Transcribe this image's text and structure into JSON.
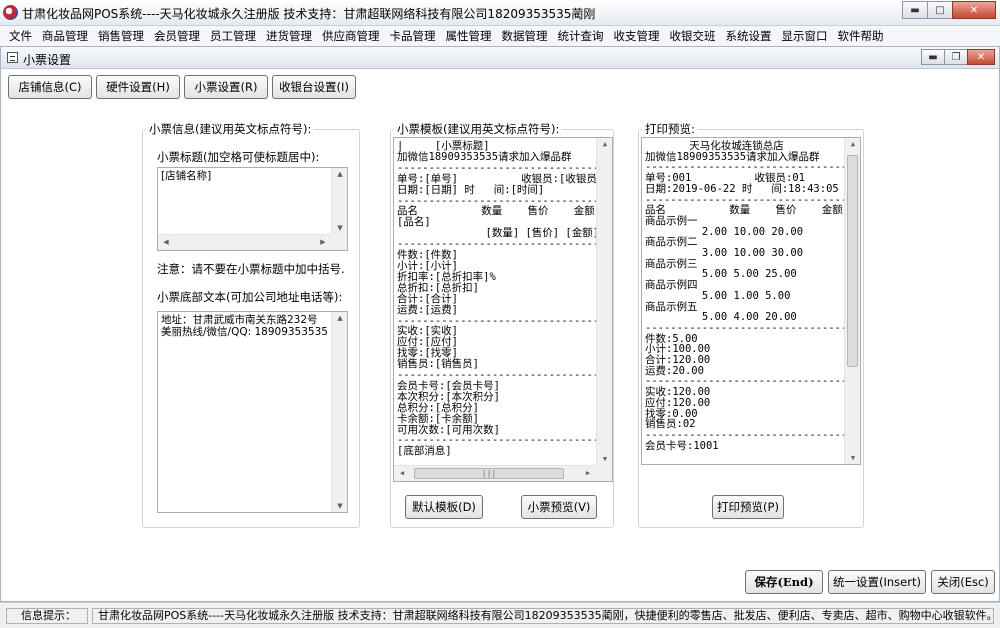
{
  "window": {
    "title": "甘肃化妆品网POS系统----天马化妆城永久注册版  技术支持：甘肃超联网络科技有限公司18209353535蔺刚"
  },
  "menu": [
    "文件",
    "商品管理",
    "销售管理",
    "会员管理",
    "员工管理",
    "进货管理",
    "供应商管理",
    "卡品管理",
    "属性管理",
    "数据管理",
    "统计查询",
    "收支管理",
    "收银交班",
    "系统设置",
    "显示窗口",
    "软件帮助"
  ],
  "dialog": {
    "title": "小票设置"
  },
  "tabs": [
    "店铺信息(C)",
    "硬件设置(H)",
    "小票设置(R)",
    "收银台设置(I)"
  ],
  "info_panel": {
    "caption": "小票信息(建议用英文标点符号):",
    "title_label": "小票标题(加空格可使标题居中):",
    "title_value": "[店铺名称]",
    "note": "注意：请不要在小票标题中加中括号.",
    "footer_label": "小票底部文本(可加公司地址电话等):",
    "footer_value": "地址：甘肃武威市南关东路232号\n美丽热线/微信/QQ: 18909353535"
  },
  "template_panel": {
    "caption": "小票模板(建议用英文标点符号):",
    "content": "|     [小票标题]\n加微信18909353535请求加入爆品群\n--------------------------------\n单号:[单号]          收银员:[收银员]\n日期:[日期] 时   间:[时间]\n--------------------------------\n品名          数量    售价    金额\n[品名]\n              [数量] [售价] [金额]\n--------------------------------\n件数:[件数]\n小计:[小计]\n折扣率:[总折扣率]%\n总折扣:[总折扣]\n合计:[合计]\n运费:[运费]\n--------------------------------\n实收:[实收]\n应付:[应付]\n找零:[找零]\n销售员:[销售员]\n--------------------------------\n会员卡号:[会员卡号]\n本次积分:[本次积分]\n总积分:[总积分]\n卡余额:[卡余额]\n可用次数:[可用次数]\n--------------------------------\n[底部消息]",
    "btn_default": "默认模板(D)",
    "btn_preview": "小票预览(V)"
  },
  "preview_panel": {
    "caption": "打印预览:",
    "content": "       天马化妆城连锁总店\n加微信18909353535请求加入爆品群\n--------------------------------\n单号:001          收银员:01\n日期:2019-06-22 时   间:18:43:05\n--------------------------------\n品名          数量    售价    金额\n商品示例一\n         2.00 10.00 20.00\n商品示例二\n         3.00 10.00 30.00\n商品示例三\n         5.00 5.00 25.00\n商品示例四\n         5.00 1.00 5.00\n商品示例五\n         5.00 4.00 20.00\n--------------------------------\n件数:5.00\n小计:100.00\n合计:120.00\n运费:20.00\n--------------------------------\n实收:120.00\n应付:120.00\n找零:0.00\n销售员:02\n--------------------------------\n会员卡号:1001",
    "btn_print": "打印预览(P)"
  },
  "footer_buttons": {
    "save": "保存(End)",
    "unified": "统一设置(Insert)",
    "close": "关闭(Esc)"
  },
  "statusbar": {
    "label": "信息提示：",
    "text": "甘肃化妆品网POS系统----天马化妆城永久注册版  技术支持：甘肃超联网络科技有限公司18209353535蔺刚，快捷便利的零售店、批发店、便利店、专卖店、超市、购物中心收银软件。"
  }
}
